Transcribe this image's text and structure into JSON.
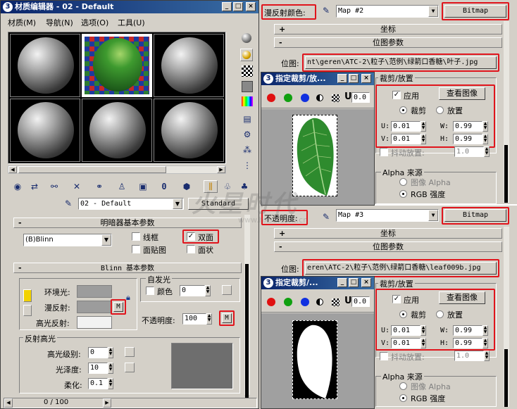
{
  "material_editor": {
    "title": "材质编辑器 - 02 - Default",
    "app_icon_glyph": "3",
    "menu": [
      "材质(M)",
      "导航(N)",
      "选项(O)",
      "工具(U)"
    ],
    "material_name": "02 - Default",
    "material_type": "Standard",
    "shader_rollout_title": "明暗器基本参数",
    "shader_type": "(B)Blinn",
    "wire_label": "线框",
    "two_sided_label": "双面",
    "face_map_label": "面贴图",
    "faceted_label": "面状",
    "blinn_rollout_title": "Blinn 基本参数",
    "self_illum_label": "自发光",
    "color_label": "颜色",
    "self_illum_value": "0",
    "ambient_label": "环境光:",
    "diffuse_label": "漫反射:",
    "specular_label": "高光反射:",
    "map_button_label": "M",
    "opacity_label": "不透明度:",
    "opacity_value": "100",
    "spec_highlights_label": "反射高光",
    "spec_level_label": "高光级别:",
    "spec_level_value": "0",
    "glossiness_label": "光泽度:",
    "glossiness_value": "10",
    "soften_label": "柔化:",
    "soften_value": "0.1",
    "status": "0 / 100"
  },
  "diffuse_panel": {
    "channel_label": "漫反射颜色:",
    "map_name": "Map #2",
    "map_type": "Bitmap",
    "coords_rollout": "坐标",
    "bitmap_rollout": "位图参数",
    "bitmap_label": "位图:",
    "bitmap_path": "nt\\geren\\ATC-2\\粒子\\范例\\绿箭口香糖\\叶子.jpg",
    "crop_window_title": "指定裁剪/放...",
    "crop_group_title": "裁剪/放置",
    "apply_label": "应用",
    "view_image_label": "查看图像",
    "crop_label": "裁剪",
    "place_label": "放置",
    "u_label": "U:",
    "u_value": "0.01",
    "v_label": "V:",
    "v_value": "0.01",
    "w_label": "W:",
    "w_value": "0.99",
    "h_label": "H:",
    "h_value": "0.99",
    "jitter_label": "抖动放置:",
    "jitter_value": "1.0",
    "alpha_source_title": "Alpha 来源",
    "image_alpha_label": "图像 Alpha",
    "rgb_intensity_label": "RGB 强度",
    "u_field_value": "0.0"
  },
  "opacity_panel": {
    "channel_label": "不透明度:",
    "map_name": "Map #3",
    "map_type": "Bitmap",
    "coords_rollout": "坐标",
    "bitmap_rollout": "位图参数",
    "bitmap_label": "位图:",
    "bitmap_path": "eren\\ATC-2\\粒子\\范例\\绿箭口香糖\\leaf009b.jpg",
    "crop_window_title": "指定裁剪/...",
    "crop_group_title": "裁剪/放置",
    "apply_label": "应用",
    "view_image_label": "查看图像",
    "crop_label": "裁剪",
    "place_label": "放置",
    "u_label": "U:",
    "u_value": "0.01",
    "v_label": "V:",
    "v_value": "0.01",
    "w_label": "W:",
    "w_value": "0.99",
    "h_label": "H:",
    "h_value": "0.99",
    "jitter_label": "抖动放置:",
    "jitter_value": "1.0",
    "alpha_source_title": "Alpha 来源",
    "image_alpha_label": "图像 Alpha",
    "rgb_intensity_label": "RGB 强度",
    "u_field_value": "0.0"
  },
  "watermark": {
    "text": "火星时代",
    "url": "www.hxsd.com.cn"
  },
  "colors": {
    "title_bar": "#0a246a",
    "highlight_red": "#e0141c",
    "leaf_green": "#2e8b2e"
  }
}
